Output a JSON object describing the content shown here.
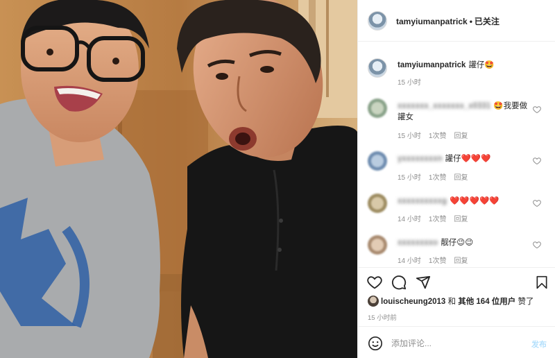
{
  "post": {
    "username": "tamyiumanpatrick",
    "follow_label": "已关注",
    "caption_text": "讙仔🤩",
    "caption_time": "15 小时"
  },
  "comments": [
    {
      "text": "🤩我要做讙女",
      "time": "15 小时",
      "likes": "1次赞",
      "reply": "回复"
    },
    {
      "text": "讙仔❤️❤️❤️",
      "time": "15 小时",
      "likes": "1次赞",
      "reply": "回复"
    },
    {
      "text": "❤️❤️❤️❤️❤️",
      "time": "14 小时",
      "likes": "1次赞",
      "reply": "回复"
    },
    {
      "text": "靓仔😉😉",
      "time": "14 小时",
      "likes": "1次赞",
      "reply": "回复"
    }
  ],
  "likes_line": {
    "user": "louischeung2013",
    "mid": "和",
    "others": "其他 164 位用户",
    "tail": "赞了"
  },
  "post_time": "15 小时前",
  "add_comment": {
    "placeholder": "添加评论...",
    "post_label": "发布"
  },
  "colors": {
    "accent": "#0095f6",
    "heart": "#ed4956",
    "muted": "#8e8e8e"
  },
  "icons": [
    "heart-icon",
    "comment-icon",
    "share-icon",
    "bookmark-icon",
    "emoji-icon"
  ]
}
